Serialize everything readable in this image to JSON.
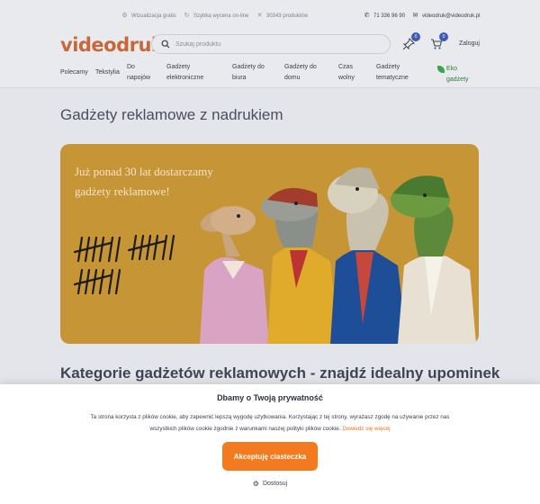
{
  "topbar": {
    "shipping": "Wizualizacja gratis",
    "quote": "Szybka wycena on-line",
    "products": "30343 produktów",
    "phone": "71 336 96 90",
    "email": "videodruk@videodruk.pl"
  },
  "header": {
    "logo": "videodruk",
    "search_placeholder": "Szukaj produktu",
    "favorites_count": "0",
    "cart_count": "0",
    "login_label": "Zaloguj"
  },
  "nav": {
    "items": [
      "Polecamy",
      "Tekstylia",
      "Do napojów",
      "Gadżety elektroniczne",
      "Gadżety do biura",
      "Gadżety do domu",
      "Czas wolny",
      "Gadżety tematyczne",
      "Eko gadżety"
    ]
  },
  "main": {
    "title": "Gadżety reklamowe z nadrukiem",
    "banner_text": "Już ponad 30 lat dostarczamy gadżety reklamowe!",
    "section_title": "Kategorie gadżetów reklamowych - znajdź idealny upominek"
  },
  "cookie": {
    "title": "Dbamy o Twoją prywatność",
    "text": "Ta strona korzysta z plików cookie, aby zapewnić lepszą wygodę użytkowania. Korzystając z tej strony, wyrażasz zgodę na używanie przez nas wszystkich plików cookie zgodnie z warunkami naszej polityki plików cookie.",
    "link": "Dowiedz się więcej",
    "accept_label": "Akceptuję ciasteczka",
    "customize_label": "Dostosuj"
  },
  "colors": {
    "brand": "#c6693a",
    "accent_button": "#f37a1f",
    "badge": "#3c5bb5",
    "banner_bg": "#c69536"
  }
}
